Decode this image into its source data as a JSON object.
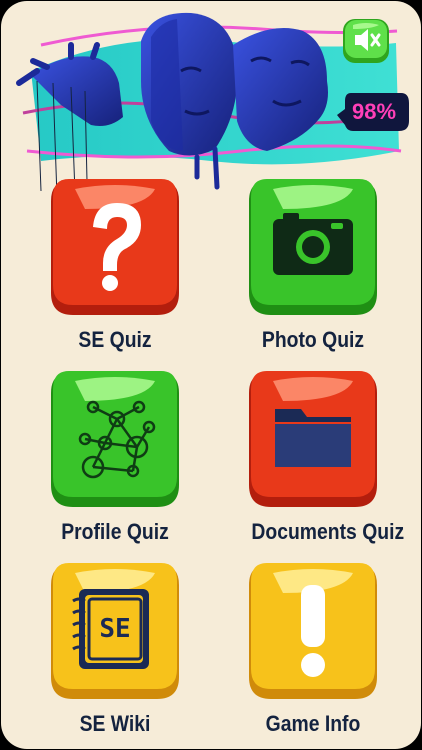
{
  "header": {
    "progress_text": "98%",
    "progress_value": 98,
    "sound_button": {
      "icon": "mute-speaker-icon",
      "state": "muted"
    }
  },
  "menu": [
    {
      "id": "se-quiz",
      "label": "SE Quiz",
      "icon": "question-mark-icon",
      "color": "red"
    },
    {
      "id": "photo-quiz",
      "label": "Photo Quiz",
      "icon": "camera-icon",
      "color": "green"
    },
    {
      "id": "profile-quiz",
      "label": "Profile Quiz",
      "icon": "network-graph-icon",
      "color": "green"
    },
    {
      "id": "documents-quiz",
      "label": "Documents Quiz",
      "icon": "folder-icon",
      "color": "red"
    },
    {
      "id": "se-wiki",
      "label": "SE Wiki",
      "icon": "notebook-icon",
      "icon_text": "SE",
      "color": "yellow"
    },
    {
      "id": "game-info",
      "label": "Game Info",
      "icon": "exclamation-mark-icon",
      "color": "yellow"
    }
  ],
  "colors": {
    "background": "#f6ecd8",
    "label": "#14233f",
    "red": "#e8391a",
    "green": "#39c42a",
    "yellow": "#f7c21b",
    "accent_pink": "#ff3fb8",
    "banner_teal": "#2ad3c7",
    "banner_blue": "#2a3bb8"
  }
}
